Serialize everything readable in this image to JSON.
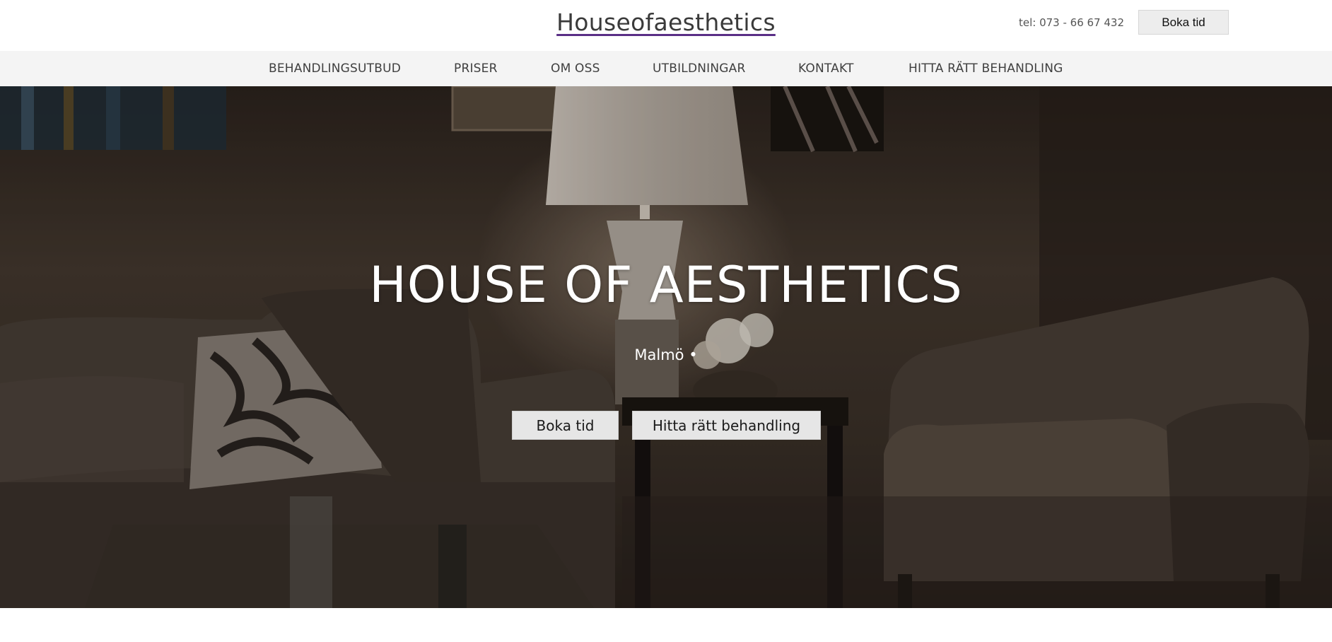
{
  "header": {
    "logo": "Houseofaesthetics",
    "phone": "tel: 073 - 66 67 432",
    "book_label": "Boka tid"
  },
  "nav": {
    "items": [
      {
        "label": "BEHANDLINGSUTBUD"
      },
      {
        "label": "PRISER"
      },
      {
        "label": "OM OSS"
      },
      {
        "label": "UTBILDNINGAR"
      },
      {
        "label": "KONTAKT"
      },
      {
        "label": "HITTA RÄTT BEHANDLING"
      }
    ]
  },
  "hero": {
    "title": "HOUSE OF AESTHETICS",
    "subtitle": "Malmö •",
    "buttons": {
      "book": "Boka tid",
      "find": "Hitta rätt behandling"
    }
  },
  "colors": {
    "accent_underline": "#5a2f86",
    "nav_background": "#f4f4f4",
    "button_background": "#e6e6e6"
  }
}
